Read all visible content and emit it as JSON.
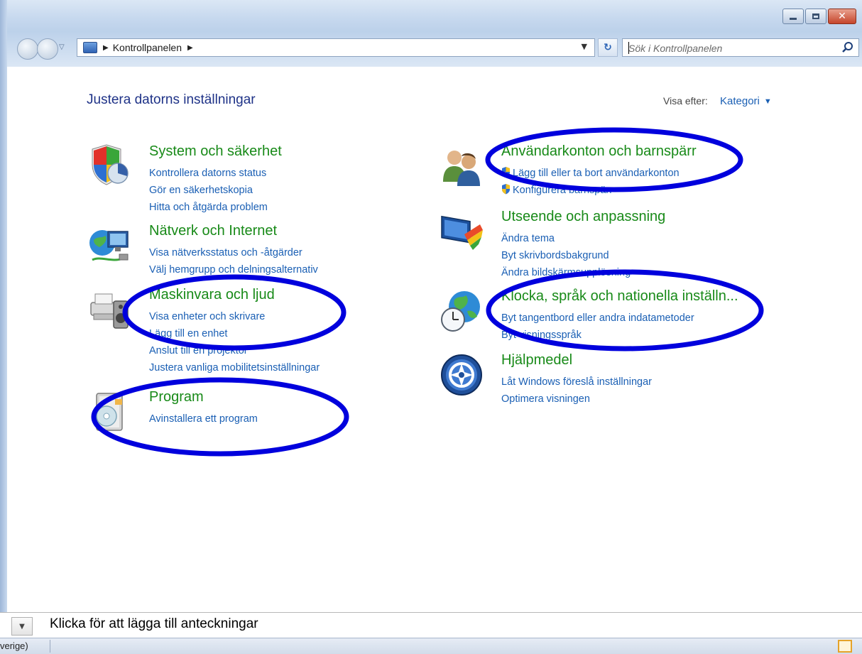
{
  "address": {
    "crumb": "Kontrollpanelen"
  },
  "search": {
    "placeholder": "Sök i Kontrollpanelen"
  },
  "header": {
    "title": "Justera datorns inställningar",
    "view_by_label": "Visa efter:",
    "view_by_value": "Kategori"
  },
  "left_column": [
    {
      "icon": "system-security-icon",
      "title": "System och säkerhet",
      "links": [
        "Kontrollera datorns status",
        "Gör en säkerhetskopia",
        "Hitta och åtgärda problem"
      ]
    },
    {
      "icon": "network-icon",
      "title": "Nätverk och Internet",
      "links": [
        "Visa nätverksstatus och -åtgärder",
        "Välj hemgrupp och delningsalternativ"
      ]
    },
    {
      "icon": "hardware-sound-icon",
      "title": "Maskinvara och ljud",
      "links": [
        "Visa enheter och skrivare",
        "Lägg till en enhet",
        "Anslut till en projektor",
        "Justera vanliga mobilitetsinställningar"
      ]
    },
    {
      "icon": "programs-icon",
      "title": "Program",
      "links": [
        "Avinstallera ett program"
      ]
    }
  ],
  "right_column": [
    {
      "icon": "user-accounts-icon",
      "title": "Användarkonton och barnspärr",
      "links": [
        "Lägg till eller ta bort användarkonton",
        "Konfigurera barnspärr"
      ]
    },
    {
      "icon": "appearance-icon",
      "title": "Utseende och anpassning",
      "links": [
        "Ändra tema",
        "Byt skrivbordsbakgrund",
        "Ändra bildskärmsupplösning"
      ]
    },
    {
      "icon": "clock-language-icon",
      "title": "Klocka, språk och nationella inställn...",
      "links": [
        "Byt tangentbord eller andra indatametoder",
        "Byt visningsspråk"
      ]
    },
    {
      "icon": "ease-of-access-icon",
      "title": "Hjälpmedel",
      "links": [
        "Låt Windows föreslå inställningar",
        "Optimera visningen"
      ]
    }
  ],
  "notes": {
    "text": "Klicka för att lägga till anteckningar"
  },
  "status": {
    "text": "verige)"
  },
  "colors": {
    "category_title": "#188a18",
    "link": "#1a5fb4",
    "annotation": "#0000dd"
  }
}
